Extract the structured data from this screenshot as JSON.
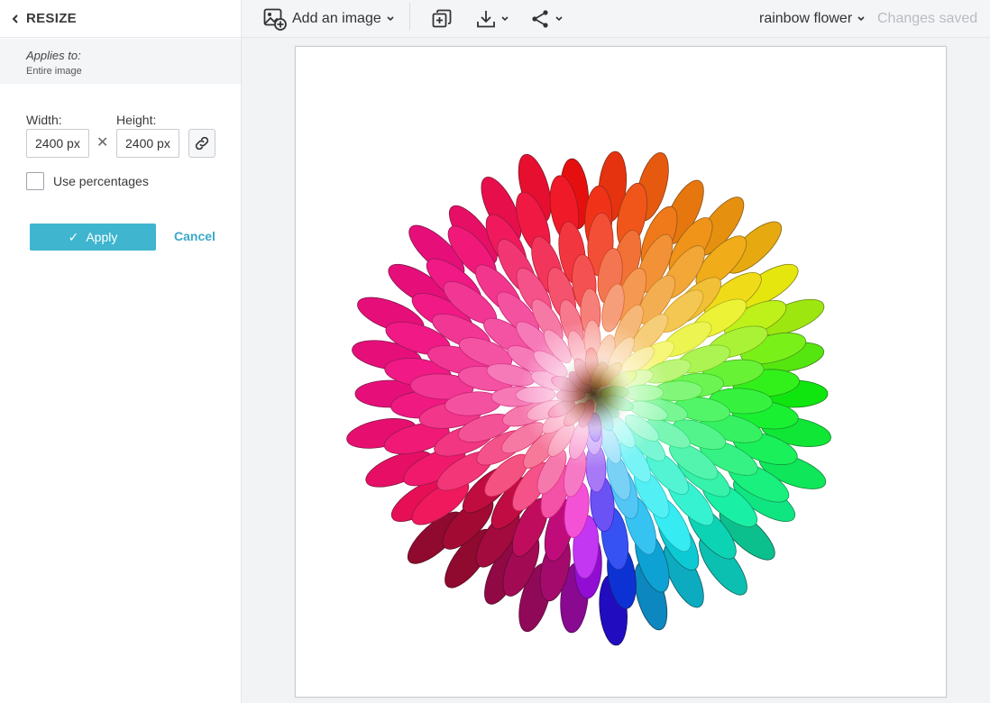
{
  "panel": {
    "title": "RESIZE",
    "applies_label": "Applies to:",
    "applies_value": "Entire image",
    "width_label": "Width:",
    "height_label": "Height:",
    "width_value": "2400 px",
    "height_value": "2400 px",
    "use_percentages_label": "Use percentages",
    "use_percentages_checked": false,
    "apply_label": "Apply",
    "cancel_label": "Cancel"
  },
  "toolbar": {
    "add_image_label": "Add an image",
    "document_name": "rainbow flower",
    "status": "Changes saved"
  },
  "icons": {
    "back": "chevron-left-icon",
    "add_image": "image-add-icon",
    "duplicate": "duplicate-icon",
    "download": "download-icon",
    "share": "share-icon",
    "link": "link-icon"
  },
  "colors": {
    "accent": "#3fb5cf",
    "cancel": "#3aa9c9",
    "status": "#b8bcc2"
  }
}
